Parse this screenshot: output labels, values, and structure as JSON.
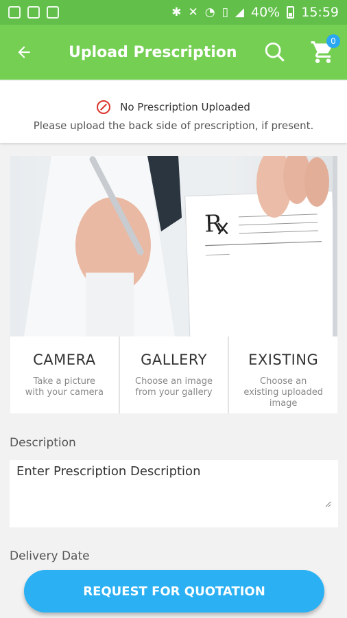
{
  "status_bar": {
    "battery": "40%",
    "time": "15:59"
  },
  "app_bar": {
    "title": "Upload Prescription",
    "cart_count": "0"
  },
  "notice": {
    "title": "No Prescription Uploaded",
    "message": "Please upload the back side of prescription, if present."
  },
  "options": [
    {
      "title": "CAMERA",
      "subtitle": "Take a picture with your camera"
    },
    {
      "title": "GALLERY",
      "subtitle": "Choose an image from your gallery"
    },
    {
      "title": "EXISTING",
      "subtitle": "Choose an existing uploaded image"
    }
  ],
  "form": {
    "description_label": "Description",
    "description_placeholder": "Enter Prescription Description",
    "delivery_date_label": "Delivery Date"
  },
  "cta": {
    "label": "REQUEST FOR QUOTATION"
  },
  "colors": {
    "app_bar": "#74cf53",
    "status_bar": "#62c04a",
    "button": "#2ab0f3"
  }
}
